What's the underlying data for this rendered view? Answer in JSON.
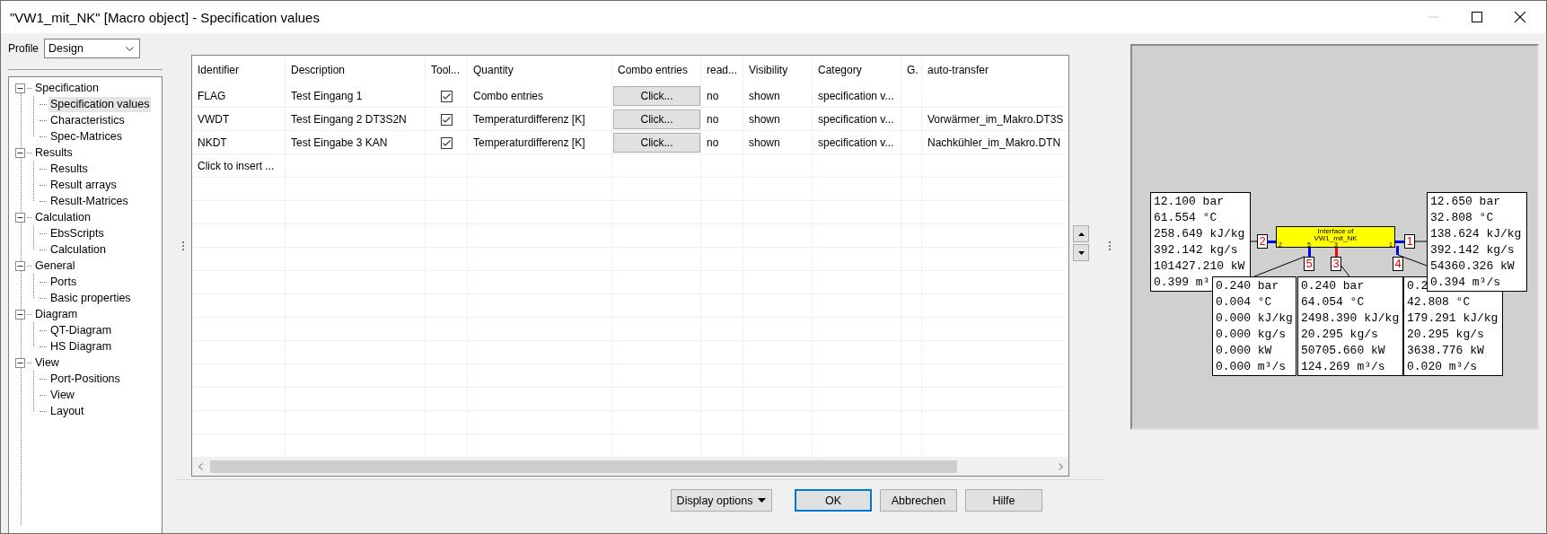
{
  "window": {
    "title": "\"VW1_mit_NK\" [Macro object] - Specification values"
  },
  "profile": {
    "label": "Profile",
    "value": "Design"
  },
  "tree": [
    {
      "label": "Specification",
      "expanded": true,
      "selected": false,
      "children": [
        {
          "label": "Specification values",
          "selected": true
        },
        {
          "label": "Characteristics",
          "selected": false
        },
        {
          "label": "Spec-Matrices",
          "selected": false
        }
      ]
    },
    {
      "label": "Results",
      "expanded": true,
      "selected": false,
      "children": [
        {
          "label": "Results",
          "selected": false
        },
        {
          "label": "Result arrays",
          "selected": false
        },
        {
          "label": "Result-Matrices",
          "selected": false
        }
      ]
    },
    {
      "label": "Calculation",
      "expanded": true,
      "selected": false,
      "children": [
        {
          "label": "EbsScripts",
          "selected": false
        },
        {
          "label": "Calculation",
          "selected": false
        }
      ]
    },
    {
      "label": "General",
      "expanded": true,
      "selected": false,
      "children": [
        {
          "label": "Ports",
          "selected": false
        },
        {
          "label": "Basic properties",
          "selected": false
        }
      ]
    },
    {
      "label": "Diagram",
      "expanded": true,
      "selected": false,
      "children": [
        {
          "label": "QT-Diagram",
          "selected": false
        },
        {
          "label": "HS Diagram",
          "selected": false
        }
      ]
    },
    {
      "label": "View",
      "expanded": true,
      "selected": false,
      "children": [
        {
          "label": "Port-Positions",
          "selected": false
        },
        {
          "label": "View",
          "selected": false
        },
        {
          "label": "Layout",
          "selected": false
        }
      ]
    }
  ],
  "table": {
    "columns": [
      "Identifier",
      "Description",
      "Tool...",
      "Quantity",
      "Combo entries",
      "read...",
      "Visibility",
      "Category",
      "G.",
      "auto-transfer"
    ],
    "rows": [
      {
        "identifier": "FLAG",
        "description": "Test Eingang 1",
        "tool_checked": true,
        "quantity": "Combo entries",
        "combo_entries": "Click...",
        "read": "no",
        "visibility": "shown",
        "category": "specification v..."
      },
      {
        "identifier": "VWDT",
        "description": "Test Eingang 2 DT3S2N",
        "tool_checked": true,
        "quantity": "Temperaturdifferenz [K]",
        "combo_entries": "Click...",
        "read": "no",
        "visibility": "shown",
        "category": "specification v...",
        "auto_transfer": "Vorwärmer_im_Makro.DT3S"
      },
      {
        "identifier": "NKDT",
        "description": "Test Eingabe 3 KAN",
        "tool_checked": true,
        "quantity": "Temperaturdifferenz [K]",
        "combo_entries": "Click...",
        "read": "no",
        "visibility": "shown",
        "category": "specification v...",
        "auto_transfer": "Nachkühler_im_Makro.DTN"
      }
    ],
    "insert_row": "Click to insert ..."
  },
  "diagram": {
    "component": {
      "label": [
        "Interface of",
        "VW1_mit_NK"
      ],
      "port_marks": [
        "2",
        "5",
        "3",
        "1"
      ]
    },
    "ports": [
      {
        "number": "2",
        "color": "#0000ff"
      },
      {
        "number": "1",
        "color": "#0000ff"
      },
      {
        "number": "5",
        "color": "#0000ff"
      },
      {
        "number": "3",
        "color": "#ff0000"
      },
      {
        "number": "4",
        "color": "#0000ff"
      }
    ],
    "value_boxes": [
      {
        "lines": [
          "12.100 bar",
          "61.554 °C",
          "258.649 kJ/kg",
          "392.142 kg/s",
          "101427.210 kW",
          "0.399 m³"
        ]
      },
      {
        "lines": [
          "0.2",
          "42.808 °C",
          "179.291 kJ/kg",
          "20.295 kg/s",
          "3638.776 kW",
          "0.020 m³/s"
        ]
      },
      {
        "lines": [
          "12.650 bar",
          "32.808 °C",
          "138.624 kJ/kg",
          "392.142 kg/s",
          "54360.326 kW",
          "0.394 m³/s"
        ]
      },
      {
        "lines": [
          "0.240 bar",
          "0.004 °C",
          "0.000 kJ/kg",
          "0.000 kg/s",
          "0.000 kW",
          "0.000 m³/s"
        ]
      },
      {
        "lines": [
          "0.240 bar",
          "64.054 °C",
          "2498.390 kJ/kg",
          "20.295 kg/s",
          "50705.660 kW",
          "124.269 m³/s"
        ]
      }
    ]
  },
  "buttons": {
    "display_options": "Display options",
    "ok": "OK",
    "cancel": "Abbrechen",
    "help": "Hilfe"
  }
}
